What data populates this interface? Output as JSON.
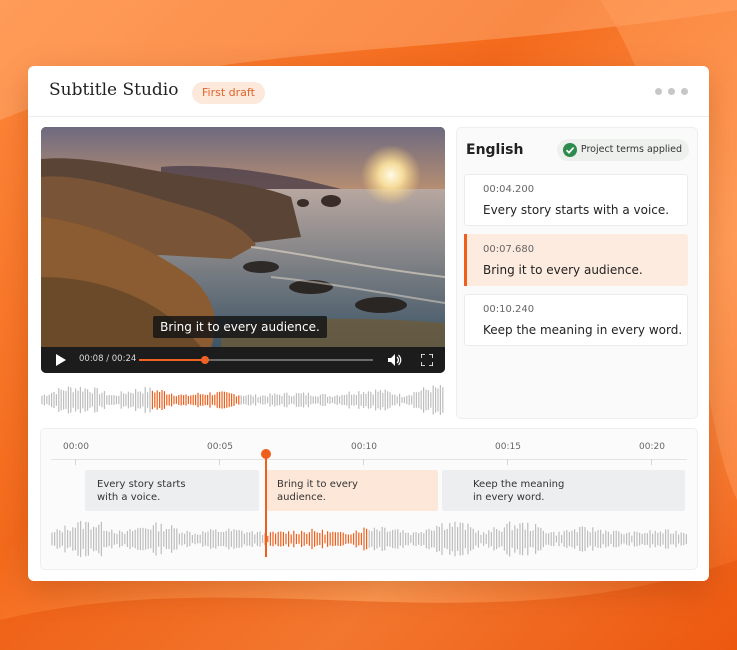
{
  "app": {
    "title": "Subtitle Studio",
    "status_badge": "First draft"
  },
  "colors": {
    "accent": "#ef5f1c",
    "active_cue_bg": "#fdebdf",
    "block_bg": "#eceef0",
    "wave_gray": "#bdbdbd"
  },
  "player": {
    "caption": "Bring it to every audience.",
    "time_readout": "00:08 / 00:24",
    "progress": 0.28,
    "icons": {
      "play": "play-icon",
      "volume": "volume-icon",
      "fullscreen": "fullscreen-icon"
    }
  },
  "subtitle_panel": {
    "language": "English",
    "terms_badge": "Project terms applied",
    "cues": [
      {
        "time": "00:04.200",
        "text": "Every story starts with a voice.",
        "active": false
      },
      {
        "time": "00:07.680",
        "text": "Bring it to every audience.",
        "active": true
      },
      {
        "time": "00:10.240",
        "text": "Keep the meaning in every word.",
        "active": false
      }
    ]
  },
  "timeline": {
    "ticks": [
      "00:00",
      "00:05",
      "00:10",
      "00:15",
      "00:20"
    ],
    "blocks": [
      {
        "line1": "Every story starts",
        "line2": "with a voice.",
        "active": false
      },
      {
        "line1": "Bring it to every",
        "line2": "audience.",
        "active": true
      },
      {
        "line1": "Keep the meaning",
        "line2": "in every word.",
        "active": false
      }
    ]
  }
}
